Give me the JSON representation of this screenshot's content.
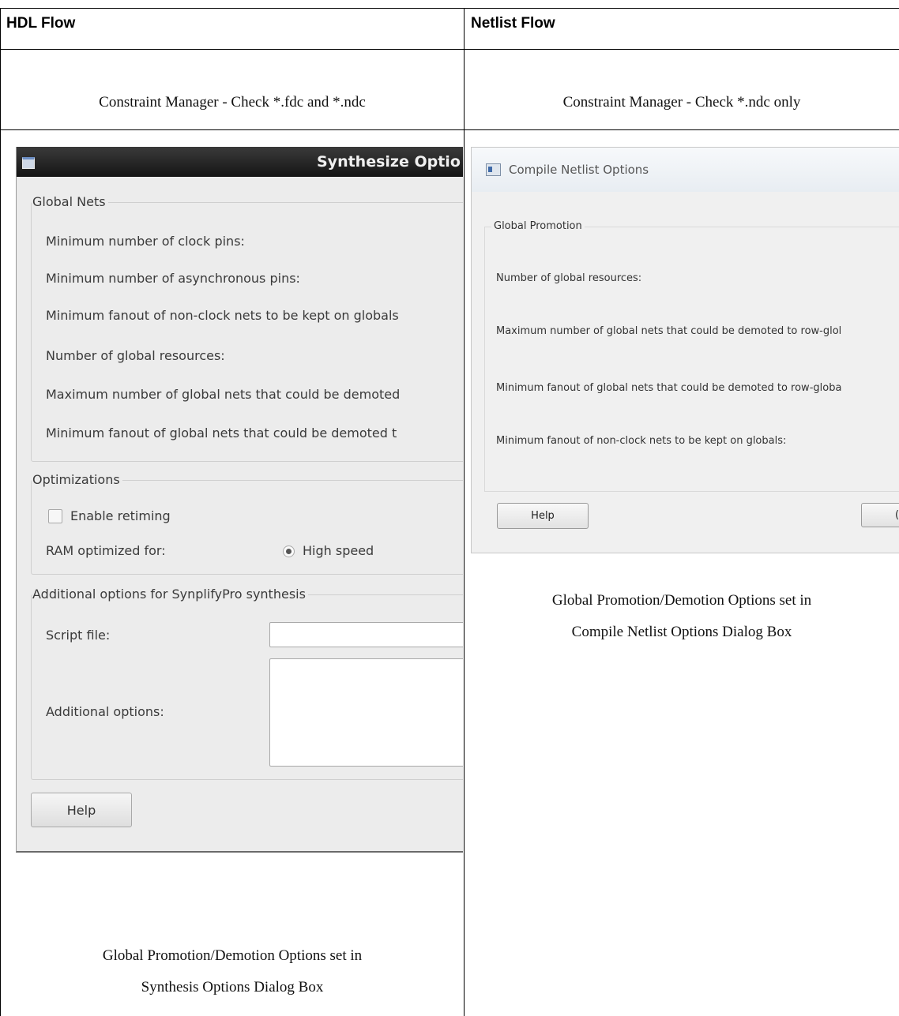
{
  "table": {
    "headers": {
      "left": "HDL Flow",
      "right": "Netlist Flow"
    },
    "constraint": {
      "left": "Constraint Manager - Check *.fdc and *.ndc",
      "right": "Constraint Manager - Check *.ndc only"
    },
    "captions": {
      "left_line1": "Global Promotion/Demotion Options set in",
      "left_line2": "Synthesis Options Dialog Box",
      "right_line1": "Global Promotion/Demotion Options set in",
      "right_line2": "Compile Netlist Options Dialog Box"
    }
  },
  "synth_dialog": {
    "title": "Synthesize Optio",
    "global_nets": {
      "legend": "Global Nets",
      "rows": [
        "Minimum number of clock pins:",
        "Minimum number of asynchronous pins:",
        "Minimum fanout of non-clock nets to be kept on globals",
        "Number of global resources:",
        "Maximum number of global nets that could be demoted",
        "Minimum fanout of global nets that could be demoted t"
      ]
    },
    "optimizations": {
      "legend": "Optimizations",
      "retiming_label": "Enable retiming",
      "ram_label": "RAM optimized for:",
      "ram_value": "High speed"
    },
    "additional": {
      "legend": "Additional options for SynplifyPro synthesis",
      "script_label": "Script file:",
      "options_label": "Additional options:"
    },
    "help_label": "Help"
  },
  "netlist_dialog": {
    "title": "Compile Netlist Options",
    "group": {
      "legend": "Global Promotion",
      "rows": [
        "Number of global resources:",
        "Maximum number of global nets that could be demoted to row-glol",
        "Minimum fanout of global nets that could be demoted to row-globa",
        "Minimum fanout of non-clock nets to be kept on globals:"
      ]
    },
    "help_label": "Help",
    "ok_partial": "("
  }
}
